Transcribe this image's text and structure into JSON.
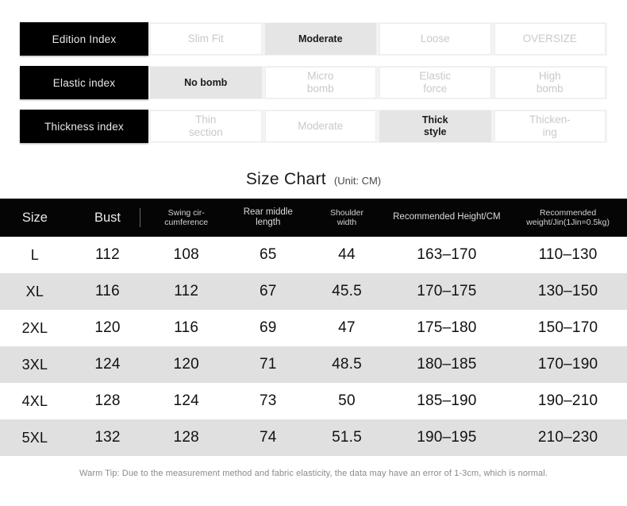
{
  "index_section": {
    "rows": [
      {
        "label": "Edition Index",
        "cells": [
          {
            "text": "Slim Fit",
            "active": false
          },
          {
            "text": "Moderate",
            "active": true
          },
          {
            "text": "Loose",
            "active": false
          },
          {
            "text": "OVERSIZE",
            "active": false
          }
        ]
      },
      {
        "label": "Elastic index",
        "cells": [
          {
            "text": "No bomb",
            "active": true
          },
          {
            "text": "Micro\nbomb",
            "active": false
          },
          {
            "text": "Elastic\nforce",
            "active": false
          },
          {
            "text": "High\nbomb",
            "active": false
          }
        ]
      },
      {
        "label": "Thickness index",
        "cells": [
          {
            "text": "Thin\nsection",
            "active": false
          },
          {
            "text": "Moderate",
            "active": false
          },
          {
            "text": "Thick\nstyle",
            "active": true
          },
          {
            "text": "Thicken-\ning",
            "active": false
          }
        ]
      }
    ]
  },
  "chart": {
    "title": "Size Chart",
    "unit": "(Unit: CM)"
  },
  "chart_data": {
    "type": "table",
    "title": "Size Chart",
    "subtitle": "(Unit: CM)",
    "columns": [
      "Size",
      "Bust",
      "Swing cir-\ncumference",
      "Rear middle\nlength",
      "Shoulder\nwidth",
      "Recommended Height/CM",
      "Recommended\nweight/Jin(1Jin=0.5kg)"
    ],
    "rows": [
      [
        "L",
        "112",
        "108",
        "65",
        "44",
        "163–170",
        "110–130"
      ],
      [
        "XL",
        "116",
        "112",
        "67",
        "45.5",
        "170–175",
        "130–150"
      ],
      [
        "2XL",
        "120",
        "116",
        "69",
        "47",
        "175–180",
        "150–170"
      ],
      [
        "3XL",
        "124",
        "120",
        "71",
        "48.5",
        "180–185",
        "170–190"
      ],
      [
        "4XL",
        "128",
        "124",
        "73",
        "50",
        "185–190",
        "190–210"
      ],
      [
        "5XL",
        "132",
        "128",
        "74",
        "51.5",
        "190–195",
        "210–230"
      ]
    ]
  },
  "warm_tip": "Warm Tip: Due to the measurement method and fabric elasticity, the data may have an error of 1-3cm, which is normal.",
  "colors": {
    "header_bg": "#050505",
    "row_stripe": "#e0e0e0",
    "active_cell": "#e5e5e5",
    "muted_text": "#c9c9c9"
  }
}
